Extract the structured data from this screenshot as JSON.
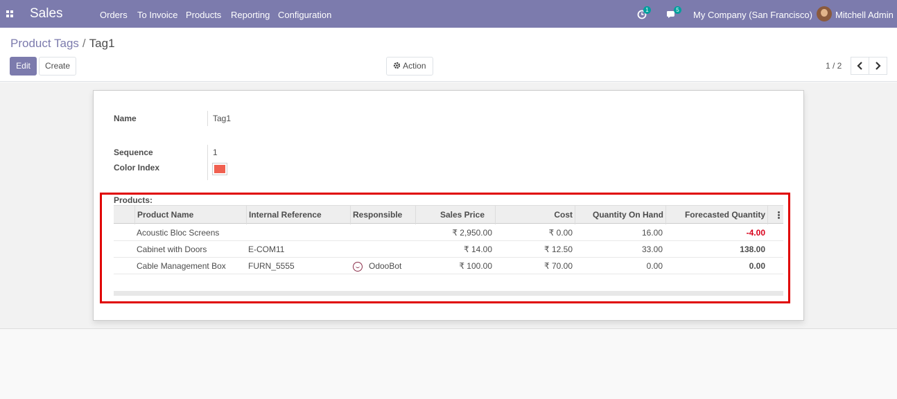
{
  "app": {
    "name": "Sales"
  },
  "nav": {
    "menu": [
      "Orders",
      "To Invoice",
      "Products",
      "Reporting",
      "Configuration"
    ],
    "activity_count": "1",
    "message_count": "5",
    "company": "My Company (San Francisco)",
    "user": "Mitchell Admin"
  },
  "breadcrumb": {
    "parent": "Product Tags",
    "separator": "/",
    "current": "Tag1"
  },
  "buttons": {
    "edit": "Edit",
    "create": "Create",
    "action": "Action"
  },
  "pager": {
    "value": "1 / 2"
  },
  "form": {
    "name_label": "Name",
    "name_value": "Tag1",
    "sequence_label": "Sequence",
    "sequence_value": "1",
    "color_label": "Color Index",
    "color_value": "#f06050",
    "products_label": "Products:"
  },
  "table": {
    "columns": [
      "Product Name",
      "Internal Reference",
      "Responsible",
      "Sales Price",
      "Cost",
      "Quantity On Hand",
      "Forecasted Quantity"
    ],
    "rows": [
      {
        "name": "Acoustic Bloc Screens",
        "ref": "",
        "responsible": "",
        "price": "₹ 2,950.00",
        "cost": "₹ 0.00",
        "on_hand": "16.00",
        "forecast": "-4.00"
      },
      {
        "name": "Cabinet with Doors",
        "ref": "E-COM11",
        "responsible": "",
        "price": "₹ 14.00",
        "cost": "₹ 12.50",
        "on_hand": "33.00",
        "forecast": "138.00"
      },
      {
        "name": "Cable Management Box",
        "ref": "FURN_5555",
        "responsible": "OdooBot",
        "price": "₹ 100.00",
        "cost": "₹ 70.00",
        "on_hand": "0.00",
        "forecast": "0.00"
      }
    ]
  },
  "colors": {
    "brand": "#7c7bad",
    "negative": "#d9001b",
    "highlight": "#e00000"
  }
}
